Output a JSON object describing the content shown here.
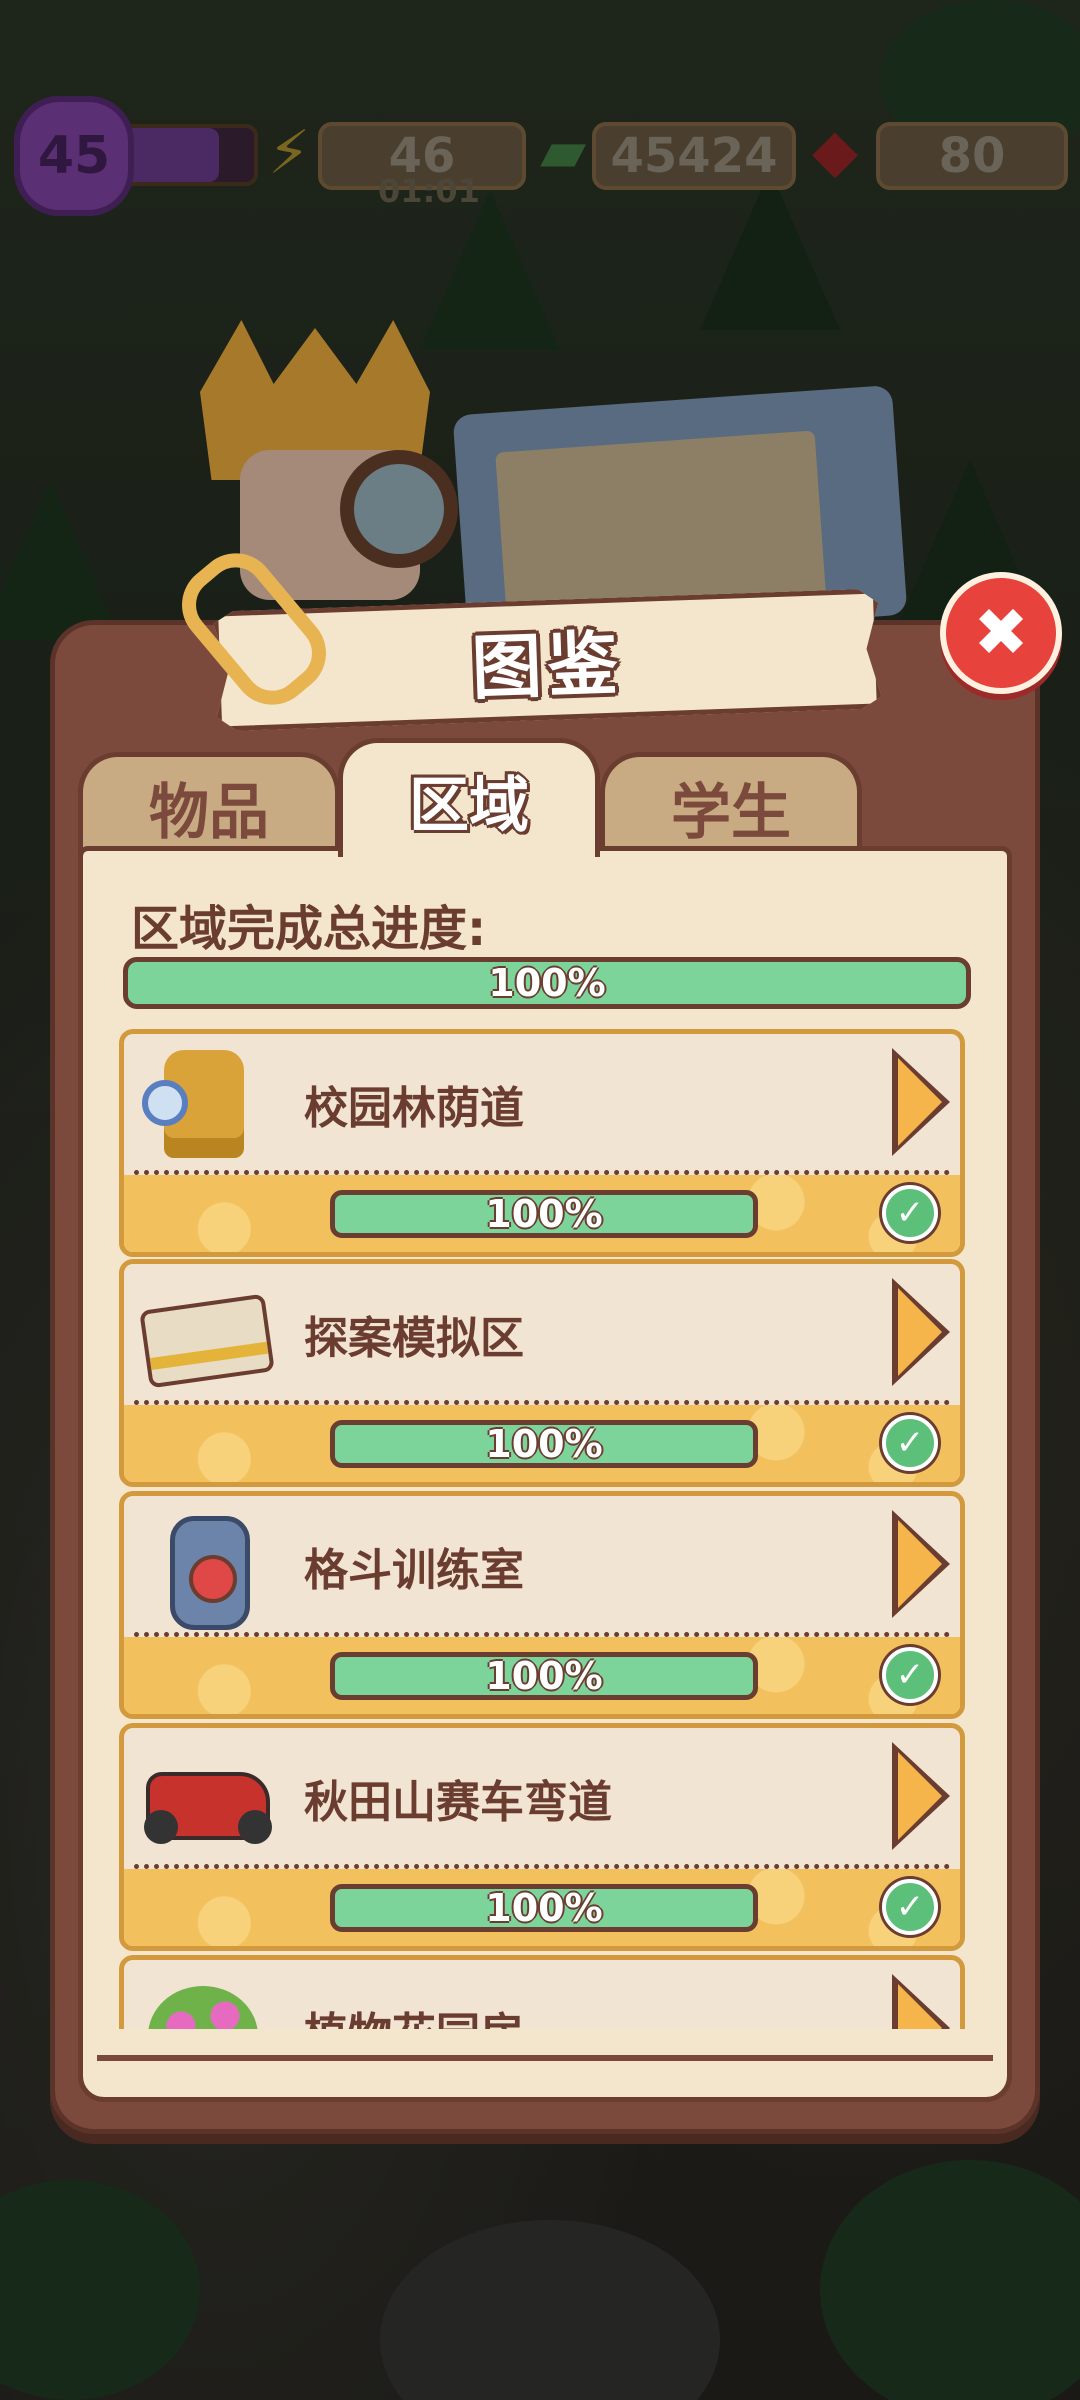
{
  "hud": {
    "level": "45",
    "level_progress": 0.75,
    "energy": "46",
    "energy_timer": "01:01",
    "cash": "45424",
    "gems": "80",
    "icons": {
      "energy": "lightning-icon",
      "cash": "cash-stack-icon",
      "gems": "ruby-gem-icon"
    }
  },
  "dialog": {
    "title": "图鉴",
    "close": "✖",
    "tabs": [
      {
        "label": "物品",
        "active": false
      },
      {
        "label": "区域",
        "active": true
      },
      {
        "label": "学生",
        "active": false
      }
    ],
    "overall": {
      "label": "区域完成总进度:",
      "percent": "100%"
    },
    "areas": [
      {
        "name": "校园林荫道",
        "percent": "100%",
        "complete": true,
        "icon": "golden-statue-icon"
      },
      {
        "name": "探案模拟区",
        "percent": "100%",
        "complete": true,
        "icon": "evidence-tape-icon"
      },
      {
        "name": "格斗训练室",
        "percent": "100%",
        "complete": true,
        "icon": "punching-bag-icon"
      },
      {
        "name": "秋田山赛车弯道",
        "percent": "100%",
        "complete": true,
        "icon": "race-kart-icon"
      },
      {
        "name": "植物花园房",
        "percent": "",
        "complete": false,
        "icon": "flower-bush-icon"
      }
    ]
  },
  "colors": {
    "panel": "#7b4a3d",
    "content_bg": "#f4e6cd",
    "progress_green": "#7cd49a",
    "card_border": "#d29a3c",
    "close_red": "#e8423c"
  }
}
